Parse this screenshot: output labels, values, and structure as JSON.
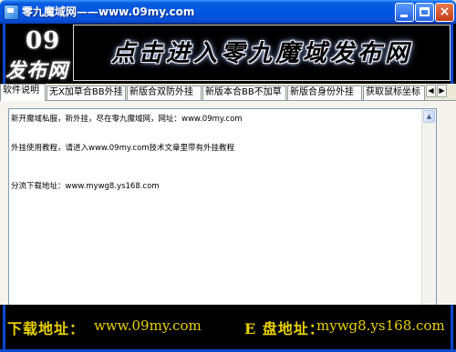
{
  "window": {
    "title": "零九魔域网——www.09my.com",
    "buttons": {
      "minimize": "_",
      "maximize": "□",
      "close": "×"
    }
  },
  "logo": {
    "number": "09",
    "subtitle": "发布网"
  },
  "banner": {
    "text": "点击进入零九魔域发布网"
  },
  "tabs": [
    {
      "label": "软件说明",
      "active": true
    },
    {
      "label": "无X加草合BB外挂",
      "active": false
    },
    {
      "label": "新版合双防外挂",
      "active": false
    },
    {
      "label": "新版本合BB不加草",
      "active": false
    },
    {
      "label": "新版合身份外挂",
      "active": false
    },
    {
      "label": "获取鼠标坐标",
      "active": false
    }
  ],
  "tab_scroll": {
    "left": "◀",
    "right": "▶"
  },
  "content": {
    "lines": [
      "新开魔域私服，新外挂，尽在零九魔域网，网址：www.09my.com",
      "外挂使用教程，请进入www.09my.com技术文章里带有外挂教程",
      "分流下载地址：www.mywg8.ys168.com"
    ],
    "scroll_up": "▲",
    "scroll_down": "▼"
  },
  "footer": {
    "download_label": "下载地址：",
    "download_url": "www.09my.com",
    "e_label": "E 盘地址：",
    "e_url": "mywg8.ys168.com"
  },
  "colors": {
    "title_bar": "#0054e3",
    "background": "#000000",
    "footer_text": "#e9d000",
    "frame_blue": "#0a48d0"
  }
}
